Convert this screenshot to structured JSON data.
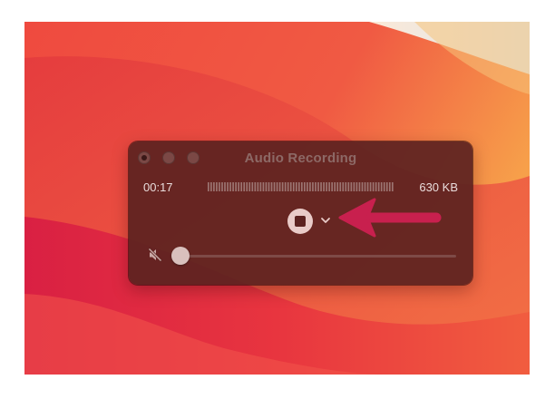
{
  "window": {
    "title": "Audio Recording"
  },
  "recording": {
    "elapsed_time": "00:17",
    "file_size": "630 KB"
  },
  "controls": {
    "stop_icon": "stop-icon",
    "options_icon": "chevron-down-icon",
    "mute_icon": "speaker-muted-icon",
    "volume_level": 0.0
  },
  "annotation": {
    "arrow_color": "#c8204e"
  },
  "colors": {
    "window_bg": "#5c2220",
    "text": "#e9dcdb",
    "title_text": "#8d6966",
    "accent_arrow": "#c8204e"
  }
}
